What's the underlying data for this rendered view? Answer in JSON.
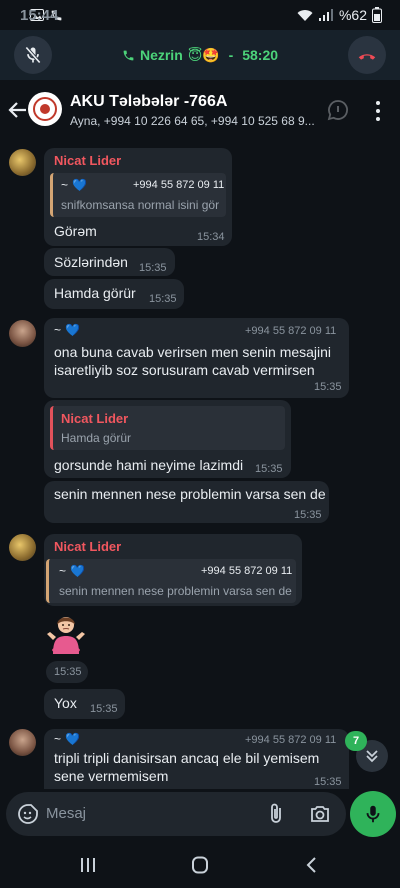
{
  "status": {
    "time": "15:44",
    "battery": "%62"
  },
  "call": {
    "name": "Nezrin",
    "emojis": "😇🤩",
    "separator": " - ",
    "duration": "58:20"
  },
  "header": {
    "title": "AKU Tələbələr -766A",
    "subtitle": "Ayna, +994 10 226 64 65, +994 10 525 68 9..."
  },
  "messages": {
    "m1": {
      "sender": "Nicat Lider",
      "quote_name": "~",
      "quote_phone": "+994 55 872 09 11",
      "quote_text": "snifkomsansa normal isini gör",
      "text": "Görəm",
      "time": "15:34"
    },
    "m2": {
      "text": "Sözlərindən",
      "time": "15:35"
    },
    "m3": {
      "text": "Hamda görür",
      "time": "15:35"
    },
    "m4": {
      "fwd_name": "~",
      "fwd_phone": "+994 55 872 09 11",
      "text_line1": "ona buna cavab verirsen men senin mesajini",
      "text_line2": "isaretliyib soz sorusuram cavab vermirsen",
      "time": "15:35"
    },
    "m5": {
      "quote_name": "Nicat Lider",
      "quote_text": "Hamda görür",
      "text": "gorsunde hami neyime lazimdi",
      "time": "15:35"
    },
    "m6": {
      "text": "senin mennen nese problemin varsa sen de",
      "time": "15:35"
    },
    "m7": {
      "sender": "Nicat Lider",
      "quote_name": "~",
      "quote_phone": "+994 55 872 09 11",
      "quote_text": "senin mennen nese problemin varsa sen de"
    },
    "m8": {
      "time": "15:35"
    },
    "m9": {
      "text": "Yox",
      "time": "15:35"
    },
    "m10": {
      "fwd_name": "~",
      "fwd_phone": "+994 55 872 09 11",
      "text_line1": "tripli tripli danisirsan ancaq ele bil yemisem",
      "text_line2": "sene vermemisem",
      "time": "15:35"
    }
  },
  "unread_badge": "7",
  "input": {
    "placeholder": "Mesaj"
  },
  "colors": {
    "accent_green": "#2fb35a",
    "sender_red": "#f1575f",
    "bubble": "#20262d",
    "background": "#0e1217"
  }
}
